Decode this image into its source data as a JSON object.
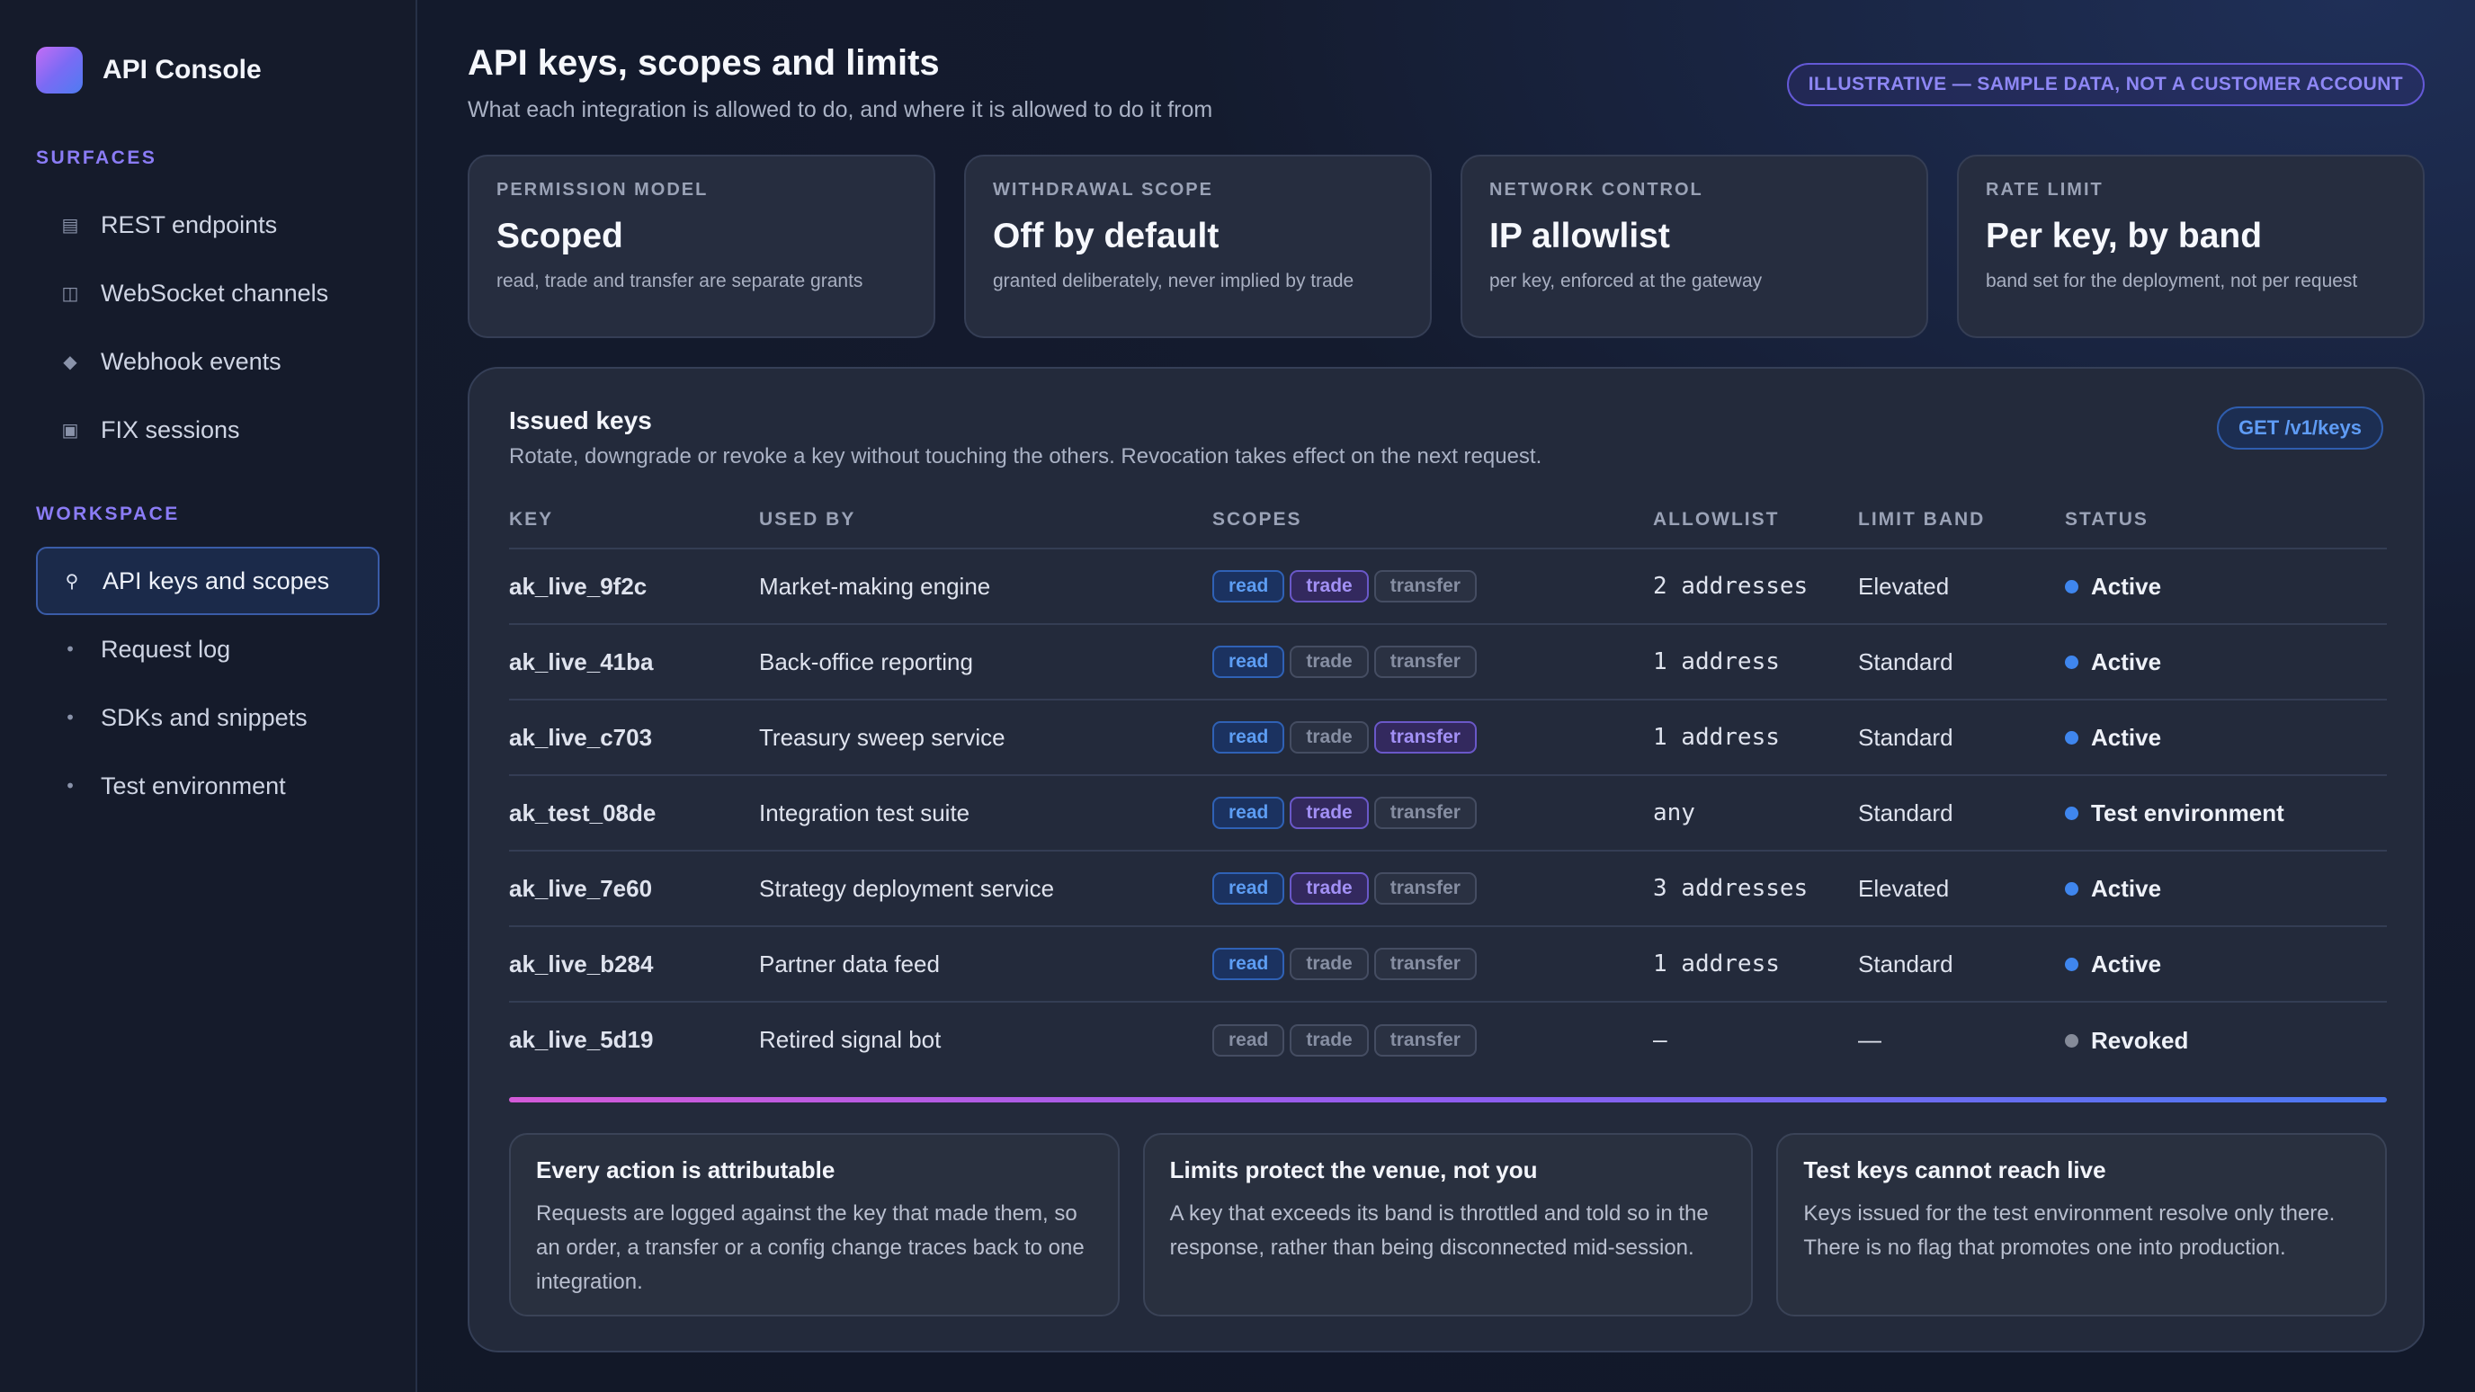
{
  "app": {
    "name": "API Console"
  },
  "sidebar": {
    "sections": [
      {
        "label": "SURFACES",
        "items": [
          {
            "label": "REST endpoints",
            "icon": "list-icon",
            "active": false
          },
          {
            "label": "WebSocket channels",
            "icon": "columns-icon",
            "active": false
          },
          {
            "label": "Webhook events",
            "icon": "diamond-icon",
            "active": false
          },
          {
            "label": "FIX sessions",
            "icon": "square-icon",
            "active": false
          }
        ]
      },
      {
        "label": "WORKSPACE",
        "items": [
          {
            "label": "API keys and scopes",
            "icon": "key-icon",
            "active": true
          },
          {
            "label": "Request log",
            "icon": "bullet-icon",
            "active": false
          },
          {
            "label": "SDKs and snippets",
            "icon": "bullet-icon",
            "active": false
          },
          {
            "label": "Test environment",
            "icon": "bullet-icon",
            "active": false
          }
        ]
      }
    ]
  },
  "header": {
    "title": "API keys, scopes and limits",
    "subtitle": "What each integration is allowed to do, and where it is allowed to do it from",
    "badge": "ILLUSTRATIVE — SAMPLE DATA, NOT A CUSTOMER ACCOUNT"
  },
  "stats": [
    {
      "label": "PERMISSION MODEL",
      "value": "Scoped",
      "desc": "read, trade and transfer are separate grants"
    },
    {
      "label": "WITHDRAWAL SCOPE",
      "value": "Off by default",
      "desc": "granted deliberately, never implied by trade"
    },
    {
      "label": "NETWORK CONTROL",
      "value": "IP allowlist",
      "desc": "per key, enforced at the gateway"
    },
    {
      "label": "RATE LIMIT",
      "value": "Per key, by band",
      "desc": "band set for the deployment, not per request"
    }
  ],
  "panel": {
    "title": "Issued keys",
    "subtitle": "Rotate, downgrade or revoke a key without touching the others. Revocation takes effect on the next request.",
    "endpoint": "GET /v1/keys",
    "columns": [
      "KEY",
      "USED BY",
      "SCOPES",
      "ALLOWLIST",
      "LIMIT BAND",
      "STATUS"
    ],
    "rows": [
      {
        "key": "ak_live_9f2c",
        "used_by": "Market-making engine",
        "scopes": {
          "read": true,
          "trade": true,
          "transfer": false
        },
        "allowlist": "2 addresses",
        "band": "Elevated",
        "status": "Active",
        "status_active": true
      },
      {
        "key": "ak_live_41ba",
        "used_by": "Back-office reporting",
        "scopes": {
          "read": true,
          "trade": false,
          "transfer": false
        },
        "allowlist": "1 address",
        "band": "Standard",
        "status": "Active",
        "status_active": true
      },
      {
        "key": "ak_live_c703",
        "used_by": "Treasury sweep service",
        "scopes": {
          "read": true,
          "trade": false,
          "transfer": true
        },
        "allowlist": "1 address",
        "band": "Standard",
        "status": "Active",
        "status_active": true
      },
      {
        "key": "ak_test_08de",
        "used_by": "Integration test suite",
        "scopes": {
          "read": true,
          "trade": true,
          "transfer": false
        },
        "allowlist": "any",
        "band": "Standard",
        "status": "Test environment",
        "status_active": true
      },
      {
        "key": "ak_live_7e60",
        "used_by": "Strategy deployment service",
        "scopes": {
          "read": true,
          "trade": true,
          "transfer": false
        },
        "allowlist": "3 addresses",
        "band": "Elevated",
        "status": "Active",
        "status_active": true
      },
      {
        "key": "ak_live_b284",
        "used_by": "Partner data feed",
        "scopes": {
          "read": true,
          "trade": false,
          "transfer": false
        },
        "allowlist": "1 address",
        "band": "Standard",
        "status": "Active",
        "status_active": true
      },
      {
        "key": "ak_live_5d19",
        "used_by": "Retired signal bot",
        "scopes": {
          "read": false,
          "trade": false,
          "transfer": false
        },
        "allowlist": "–",
        "band": "—",
        "status": "Revoked",
        "status_active": false
      }
    ],
    "scope_labels": {
      "read": "read",
      "trade": "trade",
      "transfer": "transfer"
    }
  },
  "notes": [
    {
      "title": "Every action is attributable",
      "body": "Requests are logged against the key that made them, so an order, a transfer or a config change traces back to one integration."
    },
    {
      "title": "Limits protect the venue, not you",
      "body": "A key that exceeds its band is throttled and told so in the response, rather than being disconnected mid-session."
    },
    {
      "title": "Test keys cannot reach live",
      "body": "Keys issued for the test environment resolve only there. There is no flag that promotes one into production."
    }
  ],
  "colors": {
    "accent_blue": "#3f86ee",
    "accent_purple": "#8b7cf6",
    "revoked": "#858b99"
  }
}
